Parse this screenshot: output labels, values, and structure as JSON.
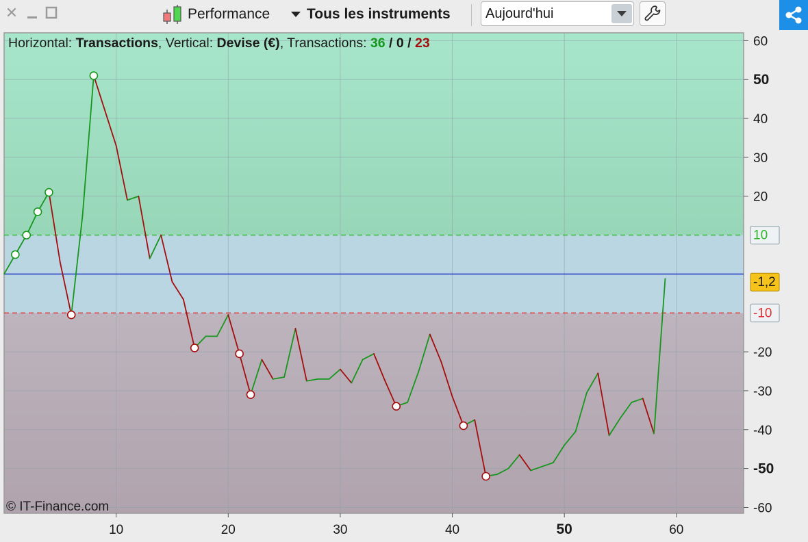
{
  "toolbar": {
    "performance_label": "Performance",
    "instruments_label": "Tous les instruments",
    "period_value": "Aujourd'hui"
  },
  "info": {
    "horizontal_prefix": "Horizontal: ",
    "horizontal_value": "Transactions",
    "vertical_prefix": ", Vertical: ",
    "vertical_value": "Devise (€)",
    "count_prefix": ", Transactions: ",
    "count_green": "36",
    "count_sep1": " / ",
    "count_zero": "0",
    "count_sep2": " / ",
    "count_red": "23"
  },
  "watermark": "© IT-Finance.com",
  "colors": {
    "up": "#16961c",
    "down": "#a50d0d",
    "zero_line": "#1228c8",
    "top_zone": "#a5e3c8",
    "mid_zone": "#bad6e2",
    "bottom_zone": "#b8adb6",
    "badge": "#f6c31a"
  },
  "chart_data": {
    "type": "line",
    "xlabel": "",
    "ylabel": "",
    "xlim": [
      0,
      66
    ],
    "ylim": [
      -61.5,
      62
    ],
    "x_ticks": [
      {
        "value": 10,
        "label": "10",
        "bold": false
      },
      {
        "value": 20,
        "label": "20",
        "bold": false
      },
      {
        "value": 30,
        "label": "30",
        "bold": false
      },
      {
        "value": 40,
        "label": "40",
        "bold": false
      },
      {
        "value": 50,
        "label": "50",
        "bold": true
      },
      {
        "value": 60,
        "label": "60",
        "bold": false
      }
    ],
    "y_ticks": [
      {
        "value": 60,
        "label": "60",
        "bold": false
      },
      {
        "value": 50,
        "label": "50",
        "bold": true
      },
      {
        "value": 40,
        "label": "40",
        "bold": false
      },
      {
        "value": 30,
        "label": "30",
        "bold": false
      },
      {
        "value": 20,
        "label": "20",
        "bold": false
      },
      {
        "value": -20,
        "label": "-20",
        "bold": false
      },
      {
        "value": -30,
        "label": "-30",
        "bold": false
      },
      {
        "value": -40,
        "label": "-40",
        "bold": false
      },
      {
        "value": -50,
        "label": "-50",
        "bold": true
      },
      {
        "value": -60,
        "label": "-60",
        "bold": false
      }
    ],
    "zones": {
      "upper": 10,
      "lower": -10
    },
    "reference_lines": [
      {
        "value": 10,
        "label": "10",
        "color": "#2fb52f"
      },
      {
        "value": 0,
        "label": "-1,2",
        "color": "#1228c8"
      },
      {
        "value": -10,
        "label": "-10",
        "color": "#e03030"
      }
    ],
    "series": [
      {
        "x": [
          0,
          1,
          2,
          3,
          4,
          5,
          6,
          7,
          8,
          9,
          10,
          11,
          12,
          13,
          14,
          15,
          16,
          17,
          18,
          19,
          20,
          21,
          22,
          23,
          24,
          25,
          26,
          27,
          28,
          29,
          30,
          31,
          32,
          33,
          34,
          35,
          36,
          37,
          38,
          39,
          40,
          41,
          42,
          43,
          44,
          45,
          46,
          47,
          48,
          49,
          50,
          51,
          52,
          53,
          54,
          55,
          56,
          57,
          58,
          59
        ],
        "y": [
          0,
          5,
          10,
          16,
          21,
          3,
          -10.5,
          15,
          51,
          42,
          33,
          19,
          20,
          4,
          10,
          -2,
          -6.5,
          -19,
          -16,
          -16,
          -10.5,
          -20.5,
          -31,
          -22,
          -27,
          -26.5,
          -14,
          -27.5,
          -27,
          -27,
          -24.5,
          -28,
          -22,
          -20.5,
          -27.5,
          -34,
          -33,
          -25,
          -15.5,
          -22.5,
          -31.5,
          -39,
          -37.5,
          -52,
          -51.5,
          -50,
          -46.5,
          -50.5,
          -49.5,
          -48.5,
          -44,
          -40.5,
          -30.5,
          -25.5,
          -41.5,
          -37,
          -33,
          -32,
          -41,
          -1.2
        ],
        "markers": [
          1,
          2,
          3,
          4,
          6,
          8,
          17,
          21,
          22,
          35,
          41,
          43
        ]
      }
    ]
  }
}
